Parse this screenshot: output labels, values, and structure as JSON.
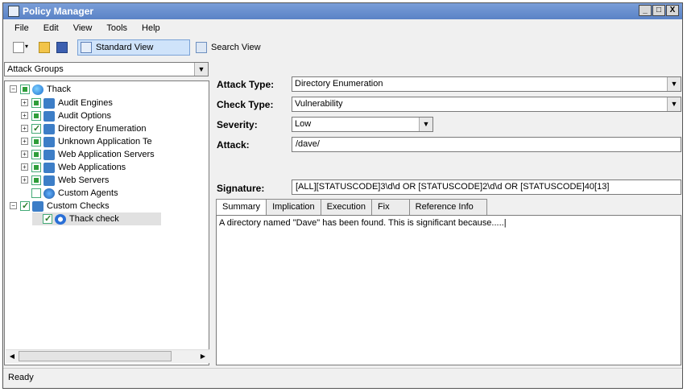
{
  "window": {
    "title": "Policy Manager",
    "controls": [
      "_",
      "□",
      "X"
    ]
  },
  "menu": [
    "File",
    "Edit",
    "View",
    "Tools",
    "Help"
  ],
  "toolbar": {
    "standard_view": "Standard View",
    "search_view": "Search View"
  },
  "left": {
    "group_select": "Attack Groups",
    "tree": [
      {
        "label": "Thack",
        "expander": "−",
        "check": "partial",
        "icon": "globe-icon"
      },
      {
        "label": "Audit Engines",
        "expander": "+",
        "check": "partial",
        "icon": "folder-icon"
      },
      {
        "label": "Audit Options",
        "expander": "+",
        "check": "partial",
        "icon": "folder-icon"
      },
      {
        "label": "Directory Enumeration",
        "expander": "+",
        "check": "on",
        "icon": "folder-icon"
      },
      {
        "label": "Unknown Application Te",
        "expander": "+",
        "check": "partial",
        "icon": "folder-icon"
      },
      {
        "label": "Web Application Servers",
        "expander": "+",
        "check": "partial",
        "icon": "folder-icon"
      },
      {
        "label": "Web Applications",
        "expander": "+",
        "check": "partial",
        "icon": "folder-icon"
      },
      {
        "label": "Web Servers",
        "expander": "+",
        "check": "partial",
        "icon": "folder-icon"
      },
      {
        "label": "Custom Agents",
        "expander": "",
        "check": "",
        "icon": "agent-icon"
      },
      {
        "label": "Custom Checks",
        "expander": "−",
        "check": "on",
        "icon": "folder-icon"
      },
      {
        "label": "Thack check",
        "expander": "",
        "check": "on",
        "icon": "check-icon"
      }
    ]
  },
  "form": {
    "attack_type_label": "Attack Type:",
    "attack_type": "Directory Enumeration",
    "check_type_label": "Check Type:",
    "check_type": "Vulnerability",
    "severity_label": "Severity:",
    "severity": "Low",
    "attack_label": "Attack:",
    "attack": "/dave/",
    "signature_label": "Signature:",
    "signature": "[ALL][STATUSCODE]3\\d\\d OR [STATUSCODE]2\\d\\d OR [STATUSCODE]40[13]"
  },
  "tabs": [
    "Summary",
    "Implication",
    "Execution",
    "Fix",
    "Reference Info"
  ],
  "summary_text": "A directory named \"Dave\" has been found. This is significant because.....|",
  "status": "Ready"
}
